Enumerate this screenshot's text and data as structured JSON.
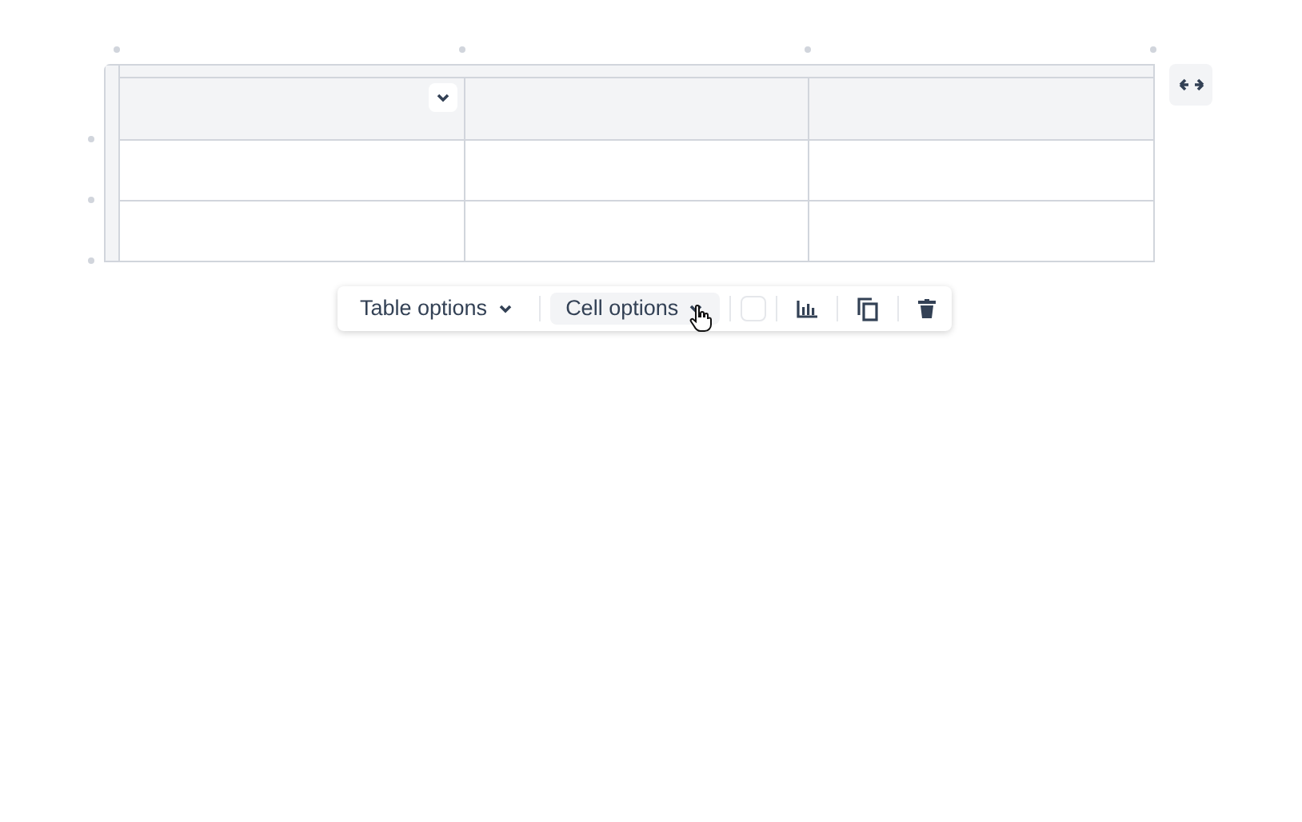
{
  "table": {
    "columns": [
      {
        "kind": "column"
      },
      {
        "kind": "column"
      },
      {
        "kind": "column"
      }
    ],
    "rows": [
      {
        "kind": "header"
      },
      {
        "kind": "body"
      },
      {
        "kind": "body"
      }
    ]
  },
  "toolbar": {
    "menus": [
      {
        "label": "Table options",
        "selected": false
      },
      {
        "label": "Cell options",
        "selected": true
      }
    ],
    "swatch": {
      "color": "#ffffff"
    }
  }
}
